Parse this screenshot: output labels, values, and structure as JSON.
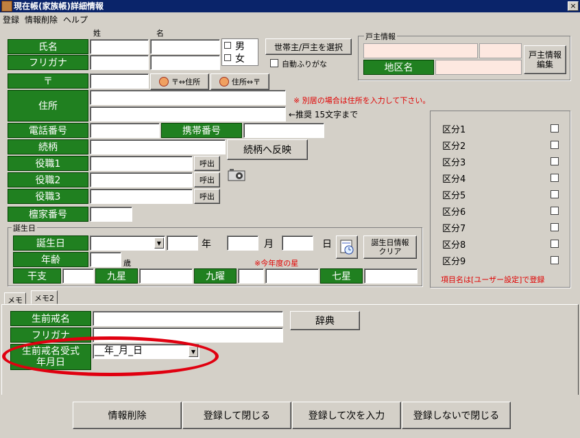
{
  "window": {
    "title": "現在帳(家族帳)詳細情報",
    "close": "×"
  },
  "menu": [
    "登録",
    "情報削除",
    "ヘルプ"
  ],
  "name": {
    "sei_hdr": "姓",
    "mei_hdr": "名",
    "label": "氏名",
    "furigana_label": "フリガナ",
    "male": "男",
    "female": "女",
    "select_head_btn": "世帯主/戸主を選択",
    "auto_furigana": "自動ふりがな"
  },
  "koshu": {
    "group": "戸主情報",
    "area_label": "地区名",
    "edit_btn": "戸主情報\n編集"
  },
  "address": {
    "zip_label": "〒",
    "zip_to_addr": "〒⇔住所",
    "addr_to_zip": "住所⇔〒",
    "addr_label": "住所",
    "note": "※ 別居の場合は住所を入力して下さい。",
    "hint": "←推奨 15文字まで"
  },
  "phone": {
    "label": "電話番号",
    "mobile_label": "携帯番号"
  },
  "relation": {
    "label": "続柄",
    "reflect_btn": "続柄へ反映"
  },
  "roles": [
    {
      "label": "役職1",
      "btn": "呼出"
    },
    {
      "label": "役職2",
      "btn": "呼出"
    },
    {
      "label": "役職3",
      "btn": "呼出"
    }
  ],
  "danka": {
    "label": "檀家番号"
  },
  "birth": {
    "group": "誕生日",
    "label": "誕生日",
    "year": "年",
    "month": "月",
    "day": "日",
    "clear_btn": "誕生日情報\nクリア",
    "age_label": "年齢",
    "age_unit": "歳",
    "note": "※今年度の星",
    "eto": "干支",
    "kyusei": "九星",
    "kuyo": "九曜",
    "shichisei": "七星"
  },
  "categories": {
    "items": [
      "区分1",
      "区分2",
      "区分3",
      "区分4",
      "区分5",
      "区分6",
      "区分7",
      "区分8",
      "区分9"
    ],
    "note": "項目名は[ユーザー設定]で登録"
  },
  "tabs": [
    "メモ",
    "メモ2"
  ],
  "memo2": {
    "kaimyo_label": "生前戒名",
    "furigana_label": "フリガナ",
    "dict_btn": "辞典",
    "date_label": "生前戒名受式\n年月日",
    "date_value": "__年_月_日"
  },
  "footer": {
    "delete": "情報削除",
    "save_close": "登録して閉じる",
    "save_next": "登録して次を入力",
    "close_nosave": "登録しないで閉じる"
  }
}
